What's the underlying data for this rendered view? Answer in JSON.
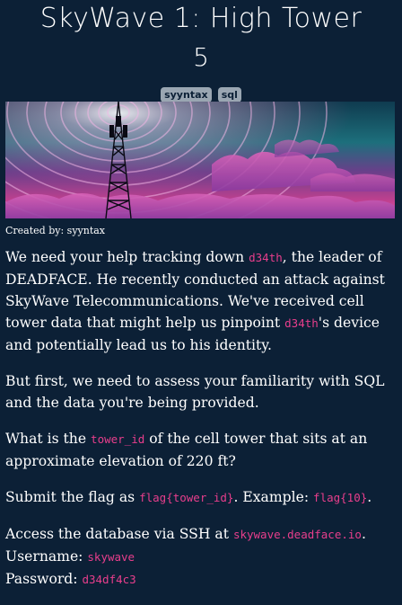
{
  "challenge": {
    "title": "SkyWave 1: High Tower",
    "points": "5",
    "tags": [
      "syyntax",
      "sql"
    ],
    "created_by": "Created by: syyntax"
  },
  "description": {
    "p1_a": "We need your help tracking down ",
    "p1_code1": "d34th",
    "p1_b": ", the leader of DEADFACE. He recently conducted an attack against SkyWave Telecommunications. We've received cell tower data that might help us pinpoint ",
    "p1_code2": "d34th",
    "p1_c": "'s device and potentially lead us to his identity.",
    "p2": "But first, we need to assess your familiarity with SQL and the data you're being provided.",
    "p3_a": "What is the ",
    "p3_code": "tower_id",
    "p3_b": " of the cell tower that sits at an approximate elevation of 220 ft?",
    "p4_a": "Submit the flag as ",
    "p4_code1": "flag{tower_id}",
    "p4_b": ". Example: ",
    "p4_code2": "flag{10}",
    "p4_c": ".",
    "p5_a": "Access the database via SSH at ",
    "p5_host": "skywave.deadface.io",
    "p5_b": ".",
    "username_label": "Username: ",
    "username": "skywave",
    "password_label": "Password: ",
    "password": "d34df4c3"
  },
  "colors": {
    "background": "#0c2036",
    "code": "#e83e8c",
    "tag_bg": "#9aa6b2"
  }
}
